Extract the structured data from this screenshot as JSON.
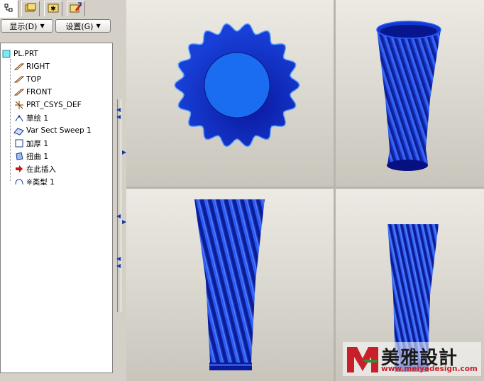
{
  "sidebar": {
    "tabs": [
      {
        "icon": "model-tree-icon"
      },
      {
        "icon": "folder-browser-icon"
      },
      {
        "icon": "favorites-icon"
      },
      {
        "icon": "connections-icon"
      }
    ],
    "show_label": "显示(D)",
    "settings_label": "设置(G)"
  },
  "tree": {
    "root": "PL.PRT",
    "items": [
      {
        "label": "RIGHT",
        "icon": "datum-plane-icon"
      },
      {
        "label": "TOP",
        "icon": "datum-plane-icon"
      },
      {
        "label": "FRONT",
        "icon": "datum-plane-icon"
      },
      {
        "label": "PRT_CSYS_DEF",
        "icon": "coordinate-system-icon"
      },
      {
        "label": "草绘 1",
        "icon": "sketch-icon"
      },
      {
        "label": "Var Sect Sweep 1",
        "icon": "variable-sweep-icon"
      },
      {
        "label": "加厚 1",
        "icon": "thicken-icon"
      },
      {
        "label": "扭曲 1",
        "icon": "warp-icon"
      },
      {
        "label": "在此插入",
        "icon": "insert-here-arrow-icon"
      },
      {
        "label": "※类型 1",
        "icon": "feature-type-icon"
      }
    ]
  },
  "watermark": {
    "brand": "美雅設計",
    "url": "www.meiyadesign.com"
  },
  "colors": {
    "model_blue": "#1a3fd8",
    "model_dark": "#06108a",
    "background_top": "#eceae3",
    "background_bottom": "#c9c5bc"
  }
}
